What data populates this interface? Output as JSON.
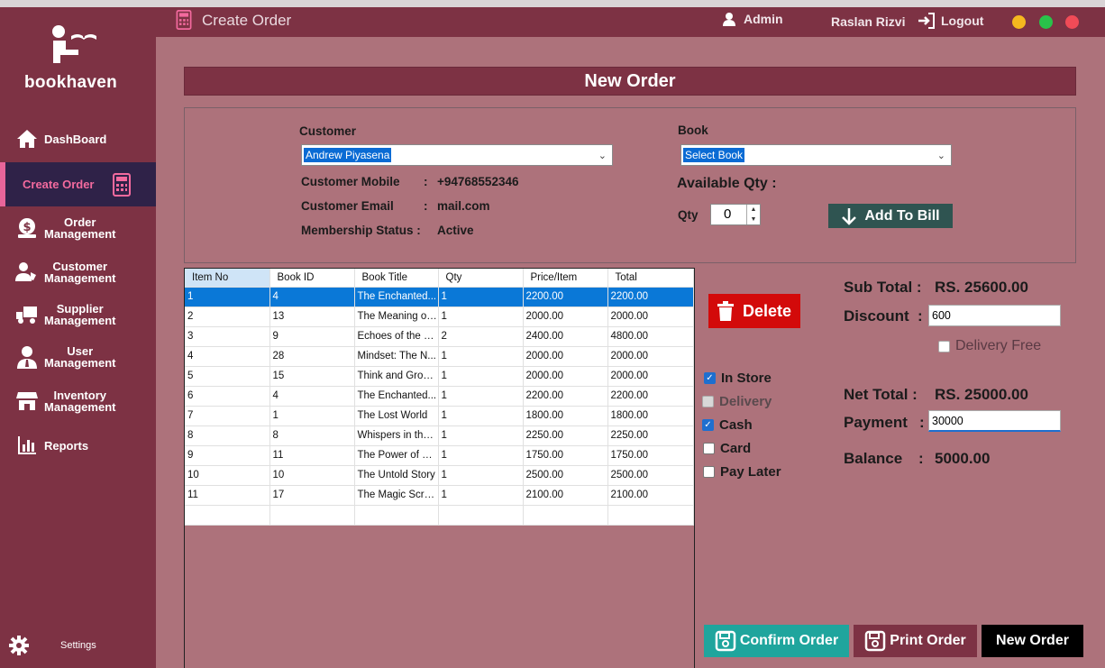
{
  "app": {
    "brand": "bookhaven",
    "window_title": "Create Order",
    "admin_label": "Admin",
    "user_name": "Raslan Rizvi",
    "logout_label": "Logout"
  },
  "sidebar": {
    "items": [
      {
        "label": "DashBoard",
        "icon": "home-icon"
      },
      {
        "label": "Create Order",
        "icon": "calculator-icon"
      },
      {
        "label": "Order\nManagement",
        "icon": "money-bag-icon"
      },
      {
        "label": "Customer\nManagement",
        "icon": "users-icon"
      },
      {
        "label": "Supplier\nManagement",
        "icon": "truck-icon"
      },
      {
        "label": "User\nManagement",
        "icon": "user-tie-icon"
      },
      {
        "label": "Inventory\nManagement",
        "icon": "store-icon"
      },
      {
        "label": "Reports",
        "icon": "chart-icon"
      }
    ],
    "settings_label": "Settings"
  },
  "page": {
    "heading": "New Order",
    "customer_label": "Customer",
    "customer_value": "Andrew Piyasena",
    "book_label": "Book",
    "book_value": "Select Book",
    "customer_mobile_label": "Customer Mobile",
    "customer_mobile": "+94768552346",
    "customer_email_label": "Customer Email",
    "customer_email": "mail.com",
    "membership_label": "Membership Status :",
    "membership": "Active",
    "available_qty_label": "Available Qty :",
    "qty_label": "Qty",
    "qty_value": "0",
    "add_to_bill": "Add To Bill"
  },
  "table": {
    "columns": [
      "Item No",
      "Book ID",
      "Book Title",
      "Qty",
      "Price/Item",
      "Total"
    ],
    "rows": [
      [
        "1",
        "4",
        "The Enchanted...",
        "1",
        "2200.00",
        "2200.00"
      ],
      [
        "2",
        "13",
        "The Meaning of...",
        "1",
        "2000.00",
        "2000.00"
      ],
      [
        "3",
        "9",
        "Echoes of the P...",
        "2",
        "2400.00",
        "4800.00"
      ],
      [
        "4",
        "28",
        "Mindset: The N...",
        "1",
        "2000.00",
        "2000.00"
      ],
      [
        "5",
        "15",
        "Think and Grow...",
        "1",
        "2000.00",
        "2000.00"
      ],
      [
        "6",
        "4",
        "The Enchanted...",
        "1",
        "2200.00",
        "2200.00"
      ],
      [
        "7",
        "1",
        "The Lost World",
        "1",
        "1800.00",
        "1800.00"
      ],
      [
        "8",
        "8",
        "Whispers in the ...",
        "1",
        "2250.00",
        "2250.00"
      ],
      [
        "9",
        "11",
        "The Power of H...",
        "1",
        "1750.00",
        "1750.00"
      ],
      [
        "10",
        "10",
        "The Untold Story",
        "1",
        "2500.00",
        "2500.00"
      ],
      [
        "11",
        "17",
        "The Magic Scrolls",
        "1",
        "2100.00",
        "2100.00"
      ]
    ]
  },
  "actions": {
    "delete": "Delete",
    "confirm": "Confirm Order",
    "print": "Print Order",
    "new": "New Order"
  },
  "options": {
    "in_store": "In Store",
    "delivery": "Delivery",
    "cash": "Cash",
    "card": "Card",
    "pay_later": "Pay Later",
    "delivery_free": "Delivery Free"
  },
  "summary": {
    "sub_total_label": "Sub Total :",
    "sub_total": "RS. 25600.00",
    "discount_label": "Discount",
    "discount": "600",
    "net_total_label": "Net Total :",
    "net_total": "RS. 25000.00",
    "payment_label": "Payment",
    "payment": "30000",
    "balance_label": "Balance",
    "balance": "5000.00"
  },
  "colors": {
    "sidebar": "#7d3244",
    "content": "#ad727b",
    "active_nav": "#2f2248",
    "delete": "#d30a0a",
    "confirm": "#1fa59d",
    "print": "#7d3244",
    "new": "#000000"
  }
}
